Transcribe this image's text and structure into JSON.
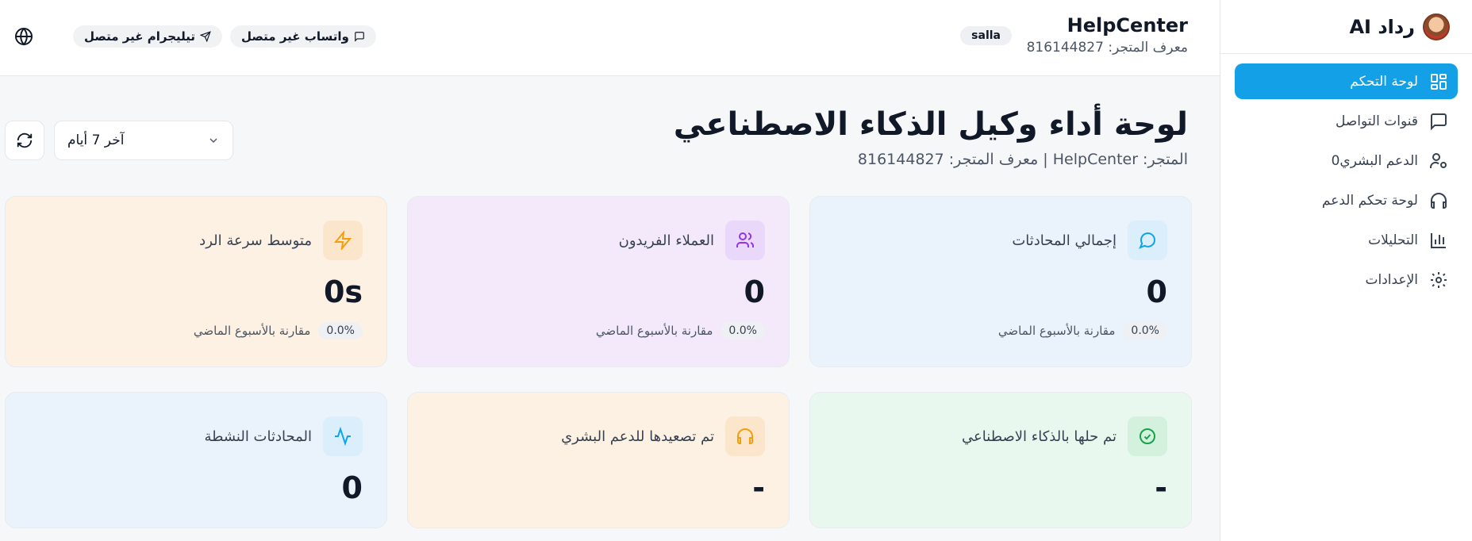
{
  "sidebar": {
    "brand_name": "رداد AI",
    "items": [
      {
        "label": "لوحة التحكم",
        "icon": "dashboard-icon",
        "active": true
      },
      {
        "label": "قنوات التواصل",
        "icon": "chat-icon",
        "active": false
      },
      {
        "label": "الدعم البشري0",
        "icon": "user-cog-icon",
        "active": false
      },
      {
        "label": "لوحة تحكم الدعم",
        "icon": "headphones-icon",
        "active": false
      },
      {
        "label": "التحليلات",
        "icon": "bar-chart-icon",
        "active": false
      },
      {
        "label": "الإعدادات",
        "icon": "settings-icon",
        "active": false
      }
    ]
  },
  "header": {
    "store_name": "HelpCenter",
    "store_id_text": "معرف المتجر: 816144827",
    "platform_badge": "salla",
    "whatsapp_status": "واتساب غير متصل",
    "telegram_status": "تيليجرام غير متصل"
  },
  "main": {
    "title": "لوحة أداء وكيل الذكاء الاصطناعي",
    "subtitle": "المتجر: HelpCenter | معرف المتجر: 816144827",
    "range_select": "آخر 7 أيام"
  },
  "cards": [
    {
      "title": "إجمالي المحادثات",
      "value": "0",
      "pct": "0.0%",
      "compare": "مقارنة بالأسبوع الماضي",
      "icon": "message-circle-icon",
      "accent": "#0ea5e9",
      "tile": "#dbeefb",
      "bg": "#eaf3fc"
    },
    {
      "title": "العملاء الفريدون",
      "value": "0",
      "pct": "0.0%",
      "compare": "مقارنة بالأسبوع الماضي",
      "icon": "users-icon",
      "accent": "#9333ea",
      "tile": "#ead8fb",
      "bg": "#f3e9fb"
    },
    {
      "title": "متوسط سرعة الرد",
      "value": "0s",
      "pct": "0.0%",
      "compare": "مقارنة بالأسبوع الماضي",
      "icon": "zap-icon",
      "accent": "#f59e0b",
      "tile": "#fbe6cc",
      "bg": "#fdf1e4"
    },
    {
      "title": "تم حلها بالذكاء الاصطناعي",
      "value": "-",
      "icon": "check-circle-icon",
      "accent": "#16a34a",
      "tile": "#d3f1dc",
      "bg": "#e9f8ee"
    },
    {
      "title": "تم تصعيدها للدعم البشري",
      "value": "-",
      "icon": "headphones-icon",
      "accent": "#f59e0b",
      "tile": "#fbe6cc",
      "bg": "#fdf1e4"
    },
    {
      "title": "المحادثات النشطة",
      "value": "0",
      "icon": "activity-icon",
      "accent": "#0ea5e9",
      "tile": "#dbeefb",
      "bg": "#eaf3fc"
    }
  ]
}
